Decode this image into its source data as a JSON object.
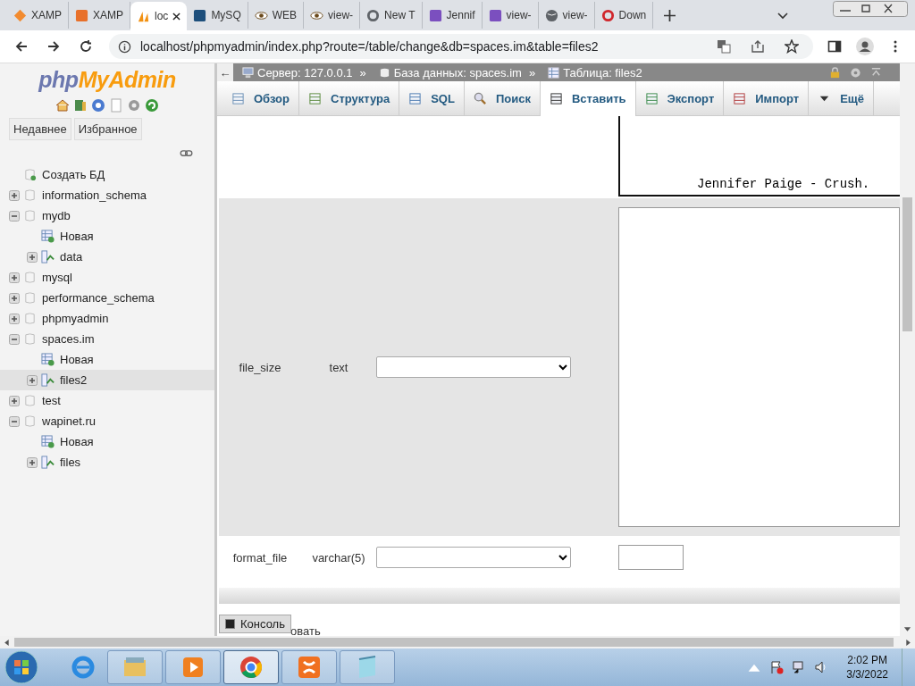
{
  "browser_tabs": [
    {
      "label": "XAMP",
      "selected": false
    },
    {
      "label": "XAMP",
      "selected": false
    },
    {
      "label": "loc",
      "selected": true
    },
    {
      "label": "MySQ",
      "selected": false
    },
    {
      "label": "WEB",
      "selected": false
    },
    {
      "label": "view-",
      "selected": false
    },
    {
      "label": "New T",
      "selected": false
    },
    {
      "label": "Jennif",
      "selected": false
    },
    {
      "label": "view-",
      "selected": false
    },
    {
      "label": "view-",
      "selected": false
    },
    {
      "label": "Down",
      "selected": false
    }
  ],
  "url": "localhost/phpmyadmin/index.php?route=/table/change&db=spaces.im&table=files2",
  "sidebar": {
    "logo_left": "php",
    "logo_right": "MyAdmin",
    "buttons": [
      "Недавнее",
      "Избранное"
    ],
    "tree": [
      {
        "label": "Создать БД",
        "kind": "new-db",
        "selected": false
      },
      {
        "label": "information_schema",
        "kind": "db",
        "expanded": false,
        "selected": false
      },
      {
        "label": "mydb",
        "kind": "db",
        "expanded": true,
        "selected": false,
        "children": [
          {
            "label": "Новая",
            "kind": "new-table",
            "selected": false
          },
          {
            "label": "data",
            "kind": "table",
            "expanded": false,
            "selected": false
          }
        ]
      },
      {
        "label": "mysql",
        "kind": "db",
        "expanded": false,
        "selected": false
      },
      {
        "label": "performance_schema",
        "kind": "db",
        "expanded": false,
        "selected": false
      },
      {
        "label": "phpmyadmin",
        "kind": "db",
        "expanded": false,
        "selected": false
      },
      {
        "label": "spaces.im",
        "kind": "db",
        "expanded": true,
        "selected": false,
        "children": [
          {
            "label": "Новая",
            "kind": "new-table",
            "selected": false
          },
          {
            "label": "files2",
            "kind": "table",
            "expanded": false,
            "selected": true
          }
        ]
      },
      {
        "label": "test",
        "kind": "db",
        "expanded": false,
        "selected": false
      },
      {
        "label": "wapinet.ru",
        "kind": "db",
        "expanded": true,
        "selected": false,
        "children": [
          {
            "label": "Новая",
            "kind": "new-table",
            "selected": false
          },
          {
            "label": "files",
            "kind": "table",
            "expanded": false,
            "selected": false
          }
        ]
      }
    ]
  },
  "breadcrumb": [
    "Сервер: 127.0.0.1",
    "База данных: spaces.im",
    "Таблица: files2"
  ],
  "breadcrumb_separator": "»",
  "back_arrow": "←",
  "tabs": [
    {
      "label": "Обзор",
      "selected": false
    },
    {
      "label": "Структура",
      "selected": false
    },
    {
      "label": "SQL",
      "selected": false
    },
    {
      "label": "Поиск",
      "selected": false
    },
    {
      "label": "Вставить",
      "selected": true
    },
    {
      "label": "Экспорт",
      "selected": false
    },
    {
      "label": "Импорт",
      "selected": false
    },
    {
      "label": "Ещё",
      "selected": false
    }
  ],
  "rows": [
    {
      "kind": "tail",
      "value": "Jennifer Paige - Crush."
    },
    {
      "kind": "textarea",
      "name": "file_size",
      "type": "text"
    },
    {
      "kind": "input",
      "name": "format_file",
      "type": "varchar(5)"
    }
  ],
  "hidden_text": "овать",
  "console": "Консоль",
  "taskbar": {
    "apps": [
      {
        "selected": false
      },
      {
        "selected": false
      },
      {
        "selected": false
      },
      {
        "selected": true
      },
      {
        "selected": false
      },
      {
        "selected": false
      }
    ],
    "time": "2:02 PM",
    "date": "3/3/2022"
  }
}
